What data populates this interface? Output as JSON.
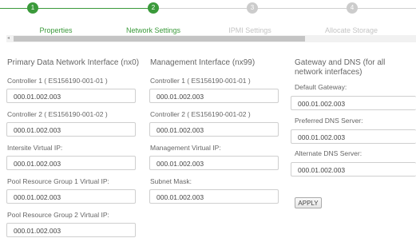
{
  "wizard": {
    "steps": [
      {
        "number": "1",
        "label": "Properties"
      },
      {
        "number": "2",
        "label": "Network Settings"
      },
      {
        "number": "3",
        "label": "IPMI Settings"
      },
      {
        "number": "4",
        "label": "Allocate Storage"
      }
    ],
    "current_step": 2
  },
  "scrollbar": {
    "left_arrow": "◂"
  },
  "primary": {
    "title": "Primary Data Network Interface (nx0)",
    "fields": [
      {
        "label": "Controller 1 ( ES156190-001-01 )",
        "value": "000.01.002.003"
      },
      {
        "label": "Controller 2 ( ES156190-001-02 )",
        "value": "000.01.002.003"
      },
      {
        "label": "Intersite Virtual IP:",
        "value": "000.01.002.003"
      },
      {
        "label": "Pool Resource Group 1 Virtual IP:",
        "value": "000.01.002.003"
      },
      {
        "label": "Pool Resource Group 2 Virtual IP:",
        "value": "000.01.002.003"
      }
    ]
  },
  "management": {
    "title": "Management Interface (nx99)",
    "fields": [
      {
        "label": "Controller 1 ( ES156190-001-01 )",
        "value": "000.01.002.003"
      },
      {
        "label": "Controller 2 ( ES156190-001-02 )",
        "value": "000.01.002.003"
      },
      {
        "label": "Management Virtual IP:",
        "value": "000.01.002.003"
      },
      {
        "label": "Subnet Mask:",
        "value": "000.01.002.003"
      }
    ]
  },
  "gateway": {
    "title": "Gateway and DNS (for all network interfaces)",
    "fields": [
      {
        "label": "Default Gateway:",
        "value": "000.01.002.003"
      },
      {
        "label": "Preferred DNS Server:",
        "value": "000.01.002.003"
      },
      {
        "label": "Alternate DNS Server:",
        "value": "000.01.002.003"
      }
    ],
    "apply_label": "APPLY"
  },
  "colors": {
    "active": "#3b9a3b",
    "done_label": "#3b9a3b",
    "inactive": "#cccccc",
    "inactive_label": "#c4c4c4"
  }
}
